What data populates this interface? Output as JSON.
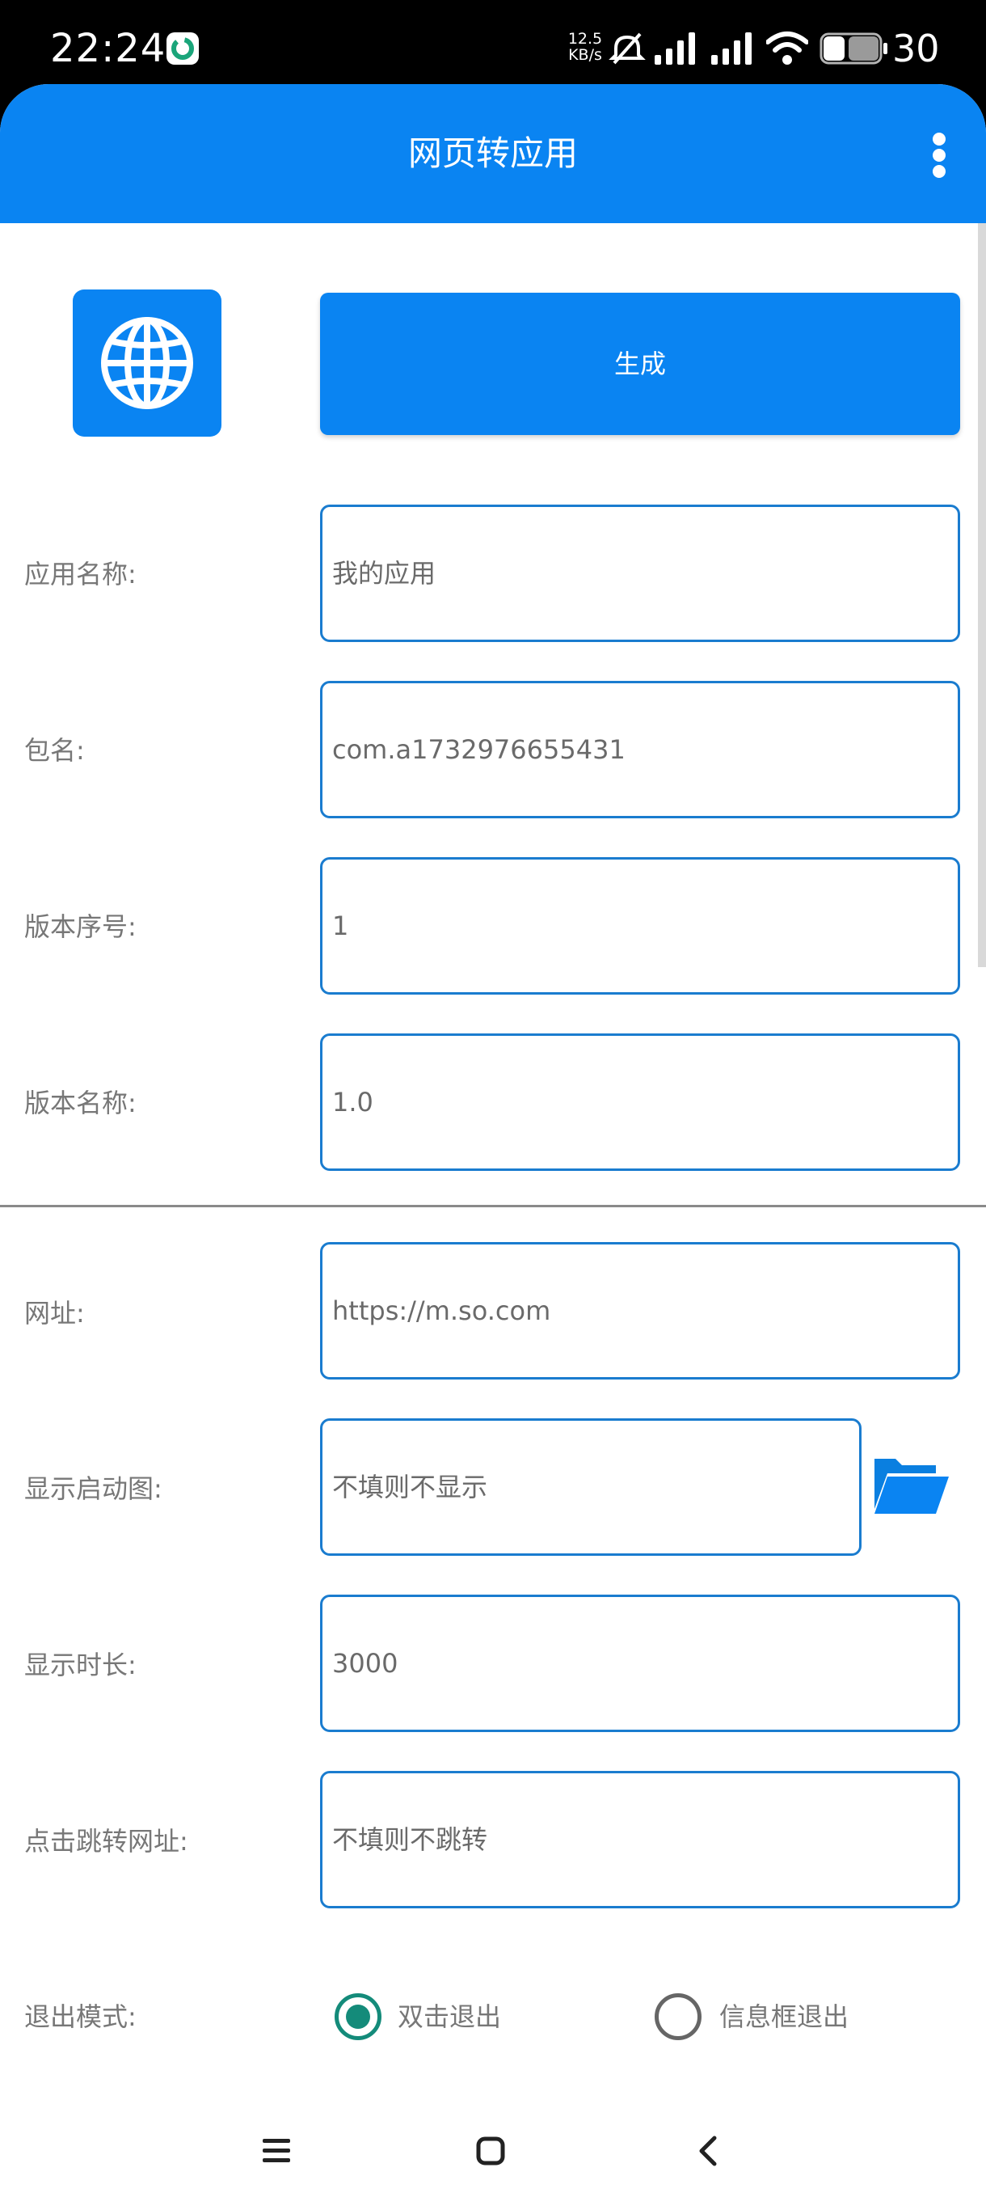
{
  "status_bar": {
    "time": "22:24",
    "net_speed_value": "12.5",
    "net_speed_unit": "KB/s",
    "battery": "30"
  },
  "app_bar": {
    "title": "网页转应用"
  },
  "actions": {
    "generate_label": "生成"
  },
  "form": {
    "app_name_label": "应用名称:",
    "app_name_value": "我的应用",
    "package_label": "包名:",
    "package_value": "com.a1732976655431",
    "version_code_label": "版本序号:",
    "version_code_value": "1",
    "version_name_label": "版本名称:",
    "version_name_value": "1.0",
    "url_label": "网址:",
    "url_value": "https://m.so.com",
    "splash_label": "显示启动图:",
    "splash_placeholder": "不填则不显示",
    "duration_label": "显示时长:",
    "duration_value": "3000",
    "click_url_label": "点击跳转网址:",
    "click_url_placeholder": "不填则不跳转",
    "exit_mode_label": "退出模式:",
    "exit_options": [
      {
        "label": "双击退出",
        "selected": true
      },
      {
        "label": "信息框退出",
        "selected": false
      }
    ]
  },
  "icons": {
    "globe": "globe-icon",
    "folder": "folder-icon",
    "more": "more-vert-icon",
    "menu": "menu-icon",
    "home": "home-icon",
    "back": "back-icon"
  },
  "colors": {
    "accent": "#0a84f2",
    "input_border": "#1a7ccf",
    "radio_checked": "#148b7a"
  }
}
